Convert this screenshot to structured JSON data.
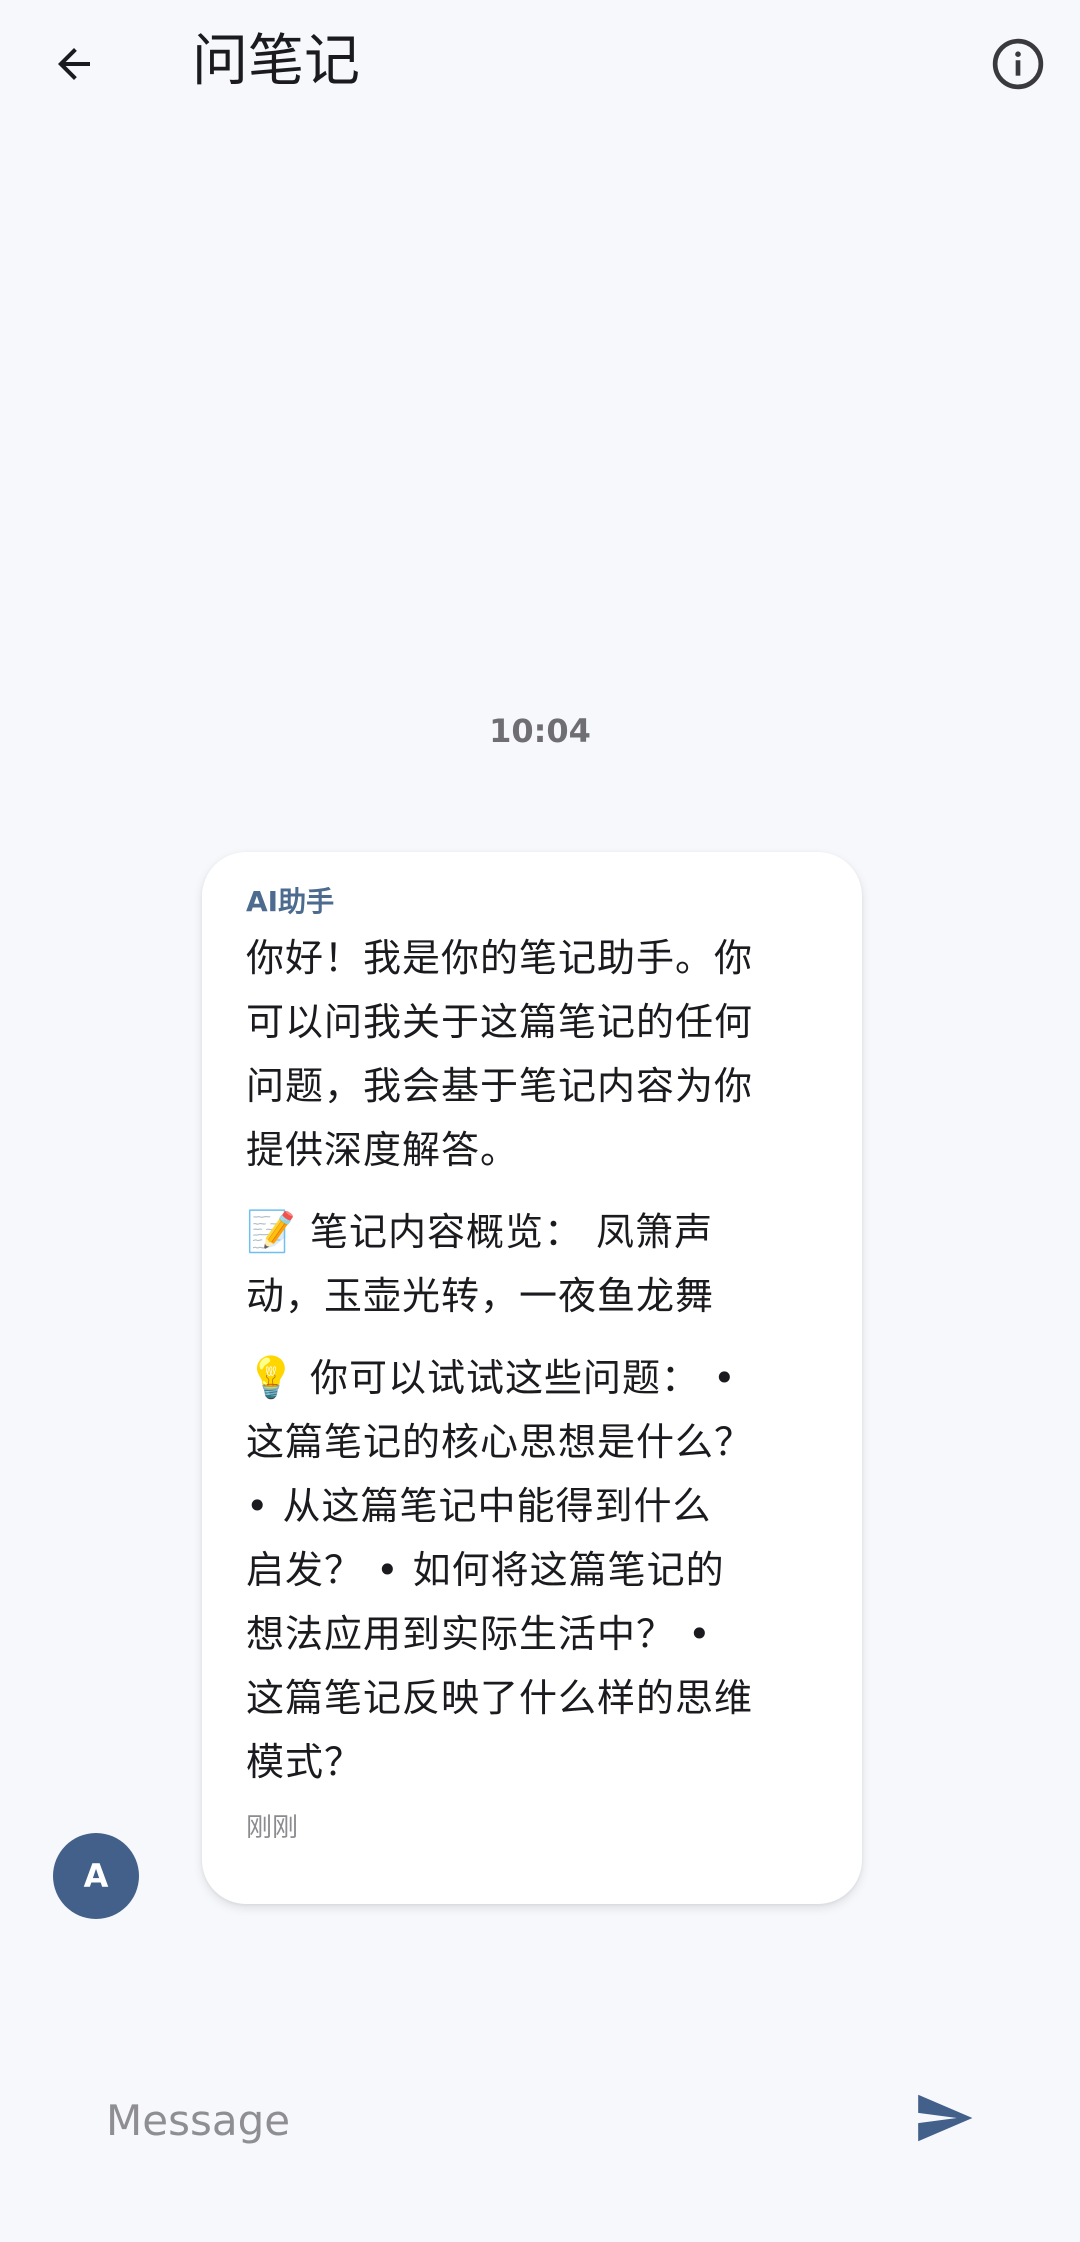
{
  "app_bar": {
    "title": "问笔记",
    "back_icon": "arrow-back-icon",
    "info_icon": "info-icon"
  },
  "conversation": {
    "time_separator": "10:04",
    "messages": [
      {
        "sender": "AI助手",
        "paragraph1": "你好！我是你的笔记助手。你\n可以问我关于这篇笔记的任何\n问题，我会基于笔记内容为你\n提供深度解答。",
        "paragraph2_emoji": "📝",
        "paragraph2_text": "笔记内容概览：  凤箫声\n动，玉壶光转，一夜鱼龙舞",
        "paragraph3_emoji": "💡",
        "paragraph3_text": "你可以试试这些问题：  •\n这篇笔记的核心思想是什么？\n  •  从这篇笔记中能得到什么\n启发？  •  如何将这篇笔记的\n想法应用到实际生活中？  •\n这篇笔记反映了什么样的思维\n模式？",
        "time": "刚刚",
        "avatar_letter": "A"
      }
    ]
  },
  "composer": {
    "placeholder": "Message",
    "value": "",
    "send_icon": "send-icon"
  },
  "colors": {
    "background": "#f6f8fc",
    "bubble": "#ffffff",
    "accent": "#426089",
    "sender_label": "#4d6a8f",
    "muted_text": "#8b8b90"
  }
}
